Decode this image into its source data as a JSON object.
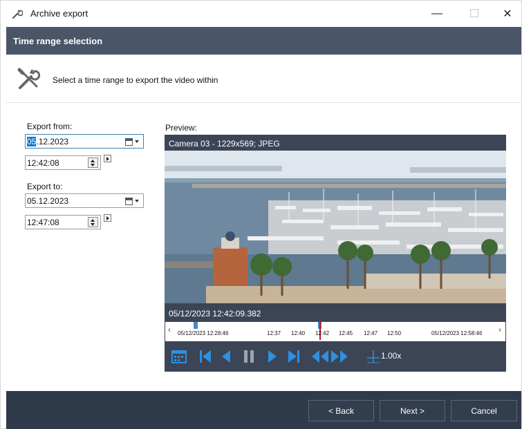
{
  "window": {
    "title": "Archive export",
    "icon": "wrench-icon"
  },
  "header": {
    "title": "Time range selection"
  },
  "description": {
    "text": "Select a time range to export the video within",
    "icon": "tools-icon"
  },
  "export_from": {
    "label": "Export from:",
    "date_selected": "05",
    "date_rest": ".12.2023",
    "time": "12:42:08"
  },
  "export_to": {
    "label": "Export to:",
    "date": "05.12.2023",
    "time": "12:47:08"
  },
  "preview": {
    "label": "Preview:",
    "camera_caption": "Camera 03 - 1229x569; JPEG",
    "timestamp": "05/12/2023 12:42:09.382",
    "timeline": {
      "start": "05/12/2023 12:28:46",
      "ticks": [
        "12:37",
        "12:40",
        "12:42",
        "12:45",
        "12:47",
        "12:50"
      ],
      "end": "05/12/2023 12:58:46"
    },
    "speed": "1.00x"
  },
  "footer": {
    "back": "< Back",
    "next": "Next >",
    "cancel": "Cancel"
  },
  "colors": {
    "header": "#4a5568",
    "preview": "#3b4555",
    "footer": "#2f3a4a",
    "accent": "#0078d7",
    "control_icons": "#2f8fe0"
  }
}
